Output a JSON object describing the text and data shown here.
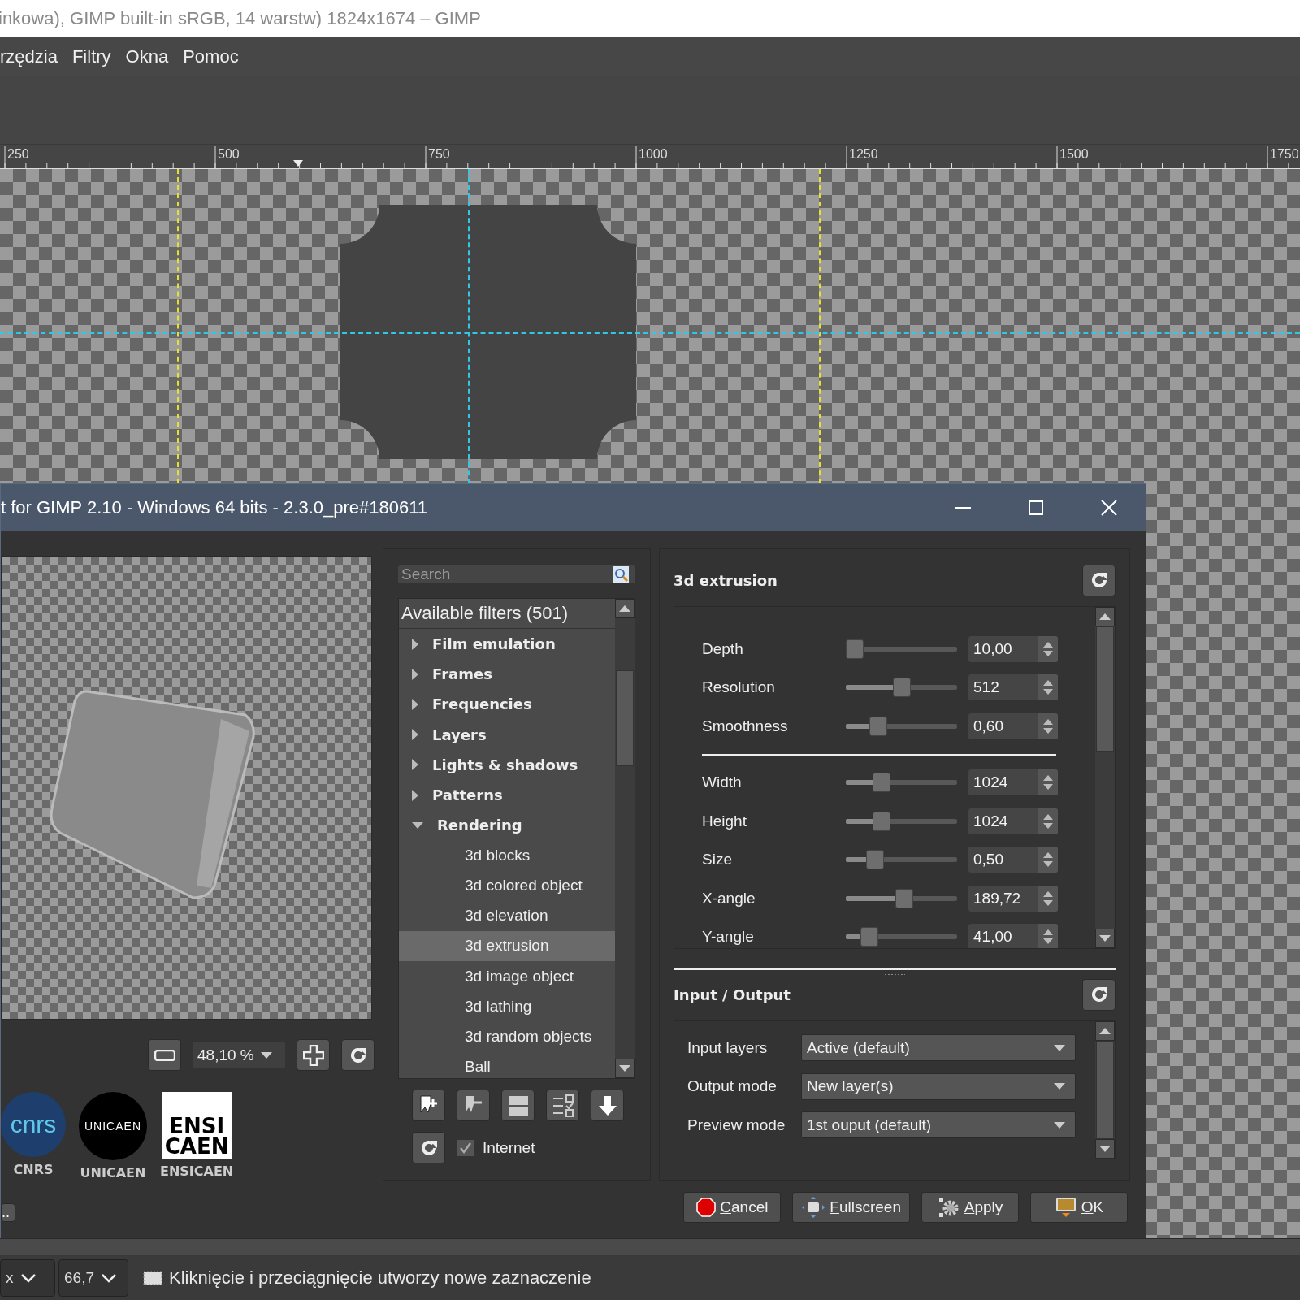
{
  "window": {
    "title": "inkowa), GIMP built-in sRGB, 14 warstw) 1824x1674 – GIMP"
  },
  "menu": [
    {
      "label": "rzędzia"
    },
    {
      "label": "Filtry"
    },
    {
      "label": "Okna"
    },
    {
      "label": "Pomoc"
    }
  ],
  "ruler": {
    "labels": [
      "250",
      "500",
      "750",
      "1000",
      "1250",
      "1500",
      "1750"
    ]
  },
  "dialog": {
    "title": "t for GIMP 2.10 - Windows 64 bits - 2.3.0_pre#180611",
    "preview": {
      "zoom": "48,10 %"
    },
    "logos": [
      {
        "kind": "cnrs",
        "mark": [
          "cnrs"
        ],
        "label": "CNRS"
      },
      {
        "kind": "unicaen",
        "mark": [
          "UNICAEN"
        ],
        "label": "UNICAEN"
      },
      {
        "kind": "ensicaen",
        "mark": [
          "ENSI",
          "CAEN"
        ],
        "label": "ENSICAEN"
      }
    ],
    "about_button": "..",
    "search": {
      "placeholder": "Search"
    },
    "filters": {
      "header": "Available filters (501)",
      "items": [
        {
          "label": "Film emulation",
          "expanded": false,
          "selected": false
        },
        {
          "label": "Frames",
          "expanded": false,
          "selected": false
        },
        {
          "label": "Frequencies",
          "expanded": false,
          "selected": false
        },
        {
          "label": "Layers",
          "expanded": false,
          "selected": false
        },
        {
          "label": "Lights & shadows",
          "expanded": false,
          "selected": false
        },
        {
          "label": "Patterns",
          "expanded": false,
          "selected": false
        },
        {
          "label": "Rendering",
          "expanded": true,
          "selected": false,
          "children": [
            {
              "label": "3d blocks",
              "selected": false
            },
            {
              "label": "3d colored object",
              "selected": false
            },
            {
              "label": "3d elevation",
              "selected": false
            },
            {
              "label": "3d extrusion",
              "selected": true
            },
            {
              "label": "3d image object",
              "selected": false
            },
            {
              "label": "3d lathing",
              "selected": false
            },
            {
              "label": "3d random objects",
              "selected": false
            },
            {
              "label": "Ball",
              "selected": false
            }
          ]
        }
      ]
    },
    "internet": {
      "label": "Internet",
      "checked": true
    },
    "filter_title": "3d extrusion",
    "params": [
      {
        "kind": "slider",
        "label": "Depth",
        "level": 0,
        "value": "10,00"
      },
      {
        "kind": "slider",
        "label": "Resolution",
        "level": 0.5,
        "value": "512"
      },
      {
        "kind": "slider",
        "label": "Smoothness",
        "level": 0.25,
        "value": "0,60"
      },
      {
        "kind": "separator"
      },
      {
        "kind": "slider",
        "label": "Width",
        "level": 0.29,
        "value": "1024"
      },
      {
        "kind": "slider",
        "label": "Height",
        "level": 0.29,
        "value": "1024"
      },
      {
        "kind": "slider",
        "label": "Size",
        "level": 0.22,
        "value": "0,50"
      },
      {
        "kind": "slider",
        "label": "X-angle",
        "level": 0.53,
        "value": "189,72"
      },
      {
        "kind": "slider",
        "label": "Y-angle",
        "level": 0.16,
        "value": "41,00"
      }
    ],
    "io": {
      "title": "Input / Output",
      "rows": [
        {
          "label": "Input layers",
          "value": "Active (default)"
        },
        {
          "label": "Output mode",
          "value": "New layer(s)"
        },
        {
          "label": "Preview mode",
          "value": "1st ouput (default)"
        }
      ]
    },
    "buttons": [
      {
        "kind": "cancel",
        "label": "Cancel"
      },
      {
        "kind": "fullscreen",
        "label": "Fullscreen"
      },
      {
        "kind": "apply",
        "label": "Apply"
      },
      {
        "kind": "ok",
        "label": "OK"
      }
    ]
  },
  "status": {
    "unit": "x",
    "zoom": "66,7",
    "message": "Kliknięcie i przeciągnięcie utworzy nowe zaznaczenie"
  }
}
